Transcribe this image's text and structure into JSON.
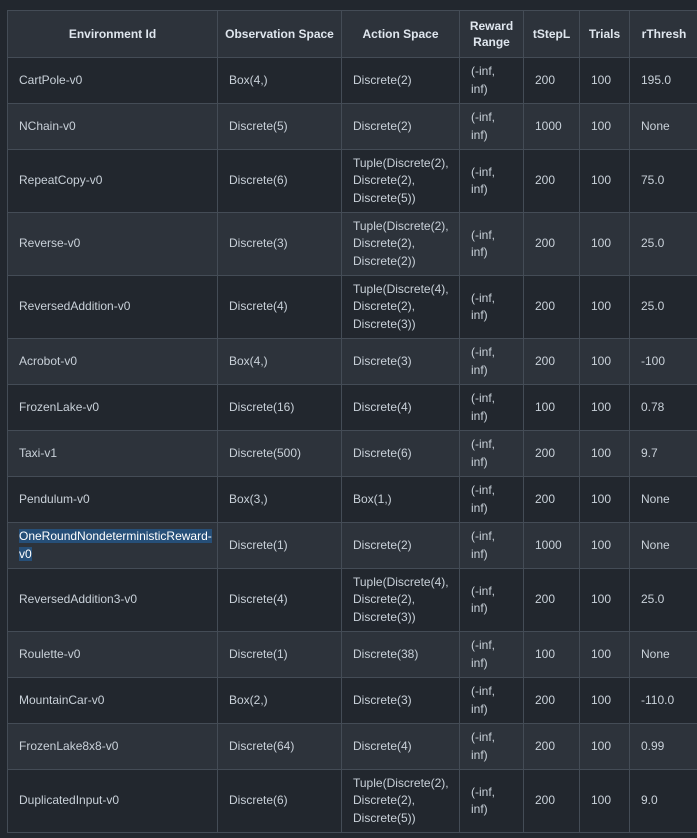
{
  "columns": [
    "Environment Id",
    "Observation Space",
    "Action Space",
    "Reward Range",
    "tStepL",
    "Trials",
    "rThresh"
  ],
  "rows": [
    {
      "env": "CartPole-v0",
      "obs": "Box(4,)",
      "act": [
        "Discrete(2)"
      ],
      "reward": [
        "(-inf,",
        "inf)"
      ],
      "tstep": "200",
      "trials": "100",
      "rthresh": "195.0"
    },
    {
      "env": "NChain-v0",
      "obs": "Discrete(5)",
      "act": [
        "Discrete(2)"
      ],
      "reward": [
        "(-inf,",
        "inf)"
      ],
      "tstep": "1000",
      "trials": "100",
      "rthresh": "None"
    },
    {
      "env": "RepeatCopy-v0",
      "obs": "Discrete(6)",
      "act": [
        "Tuple(Discrete(2),",
        "Discrete(2),",
        "Discrete(5))"
      ],
      "reward": [
        "(-inf,",
        "inf)"
      ],
      "tstep": "200",
      "trials": "100",
      "rthresh": "75.0"
    },
    {
      "env": "Reverse-v0",
      "obs": "Discrete(3)",
      "act": [
        "Tuple(Discrete(2),",
        "Discrete(2),",
        "Discrete(2))"
      ],
      "reward": [
        "(-inf,",
        "inf)"
      ],
      "tstep": "200",
      "trials": "100",
      "rthresh": "25.0"
    },
    {
      "env": "ReversedAddition-v0",
      "obs": "Discrete(4)",
      "act": [
        "Tuple(Discrete(4),",
        "Discrete(2),",
        "Discrete(3))"
      ],
      "reward": [
        "(-inf,",
        "inf)"
      ],
      "tstep": "200",
      "trials": "100",
      "rthresh": "25.0"
    },
    {
      "env": "Acrobot-v0",
      "obs": "Box(4,)",
      "act": [
        "Discrete(3)"
      ],
      "reward": [
        "(-inf,",
        "inf)"
      ],
      "tstep": "200",
      "trials": "100",
      "rthresh": "-100"
    },
    {
      "env": "FrozenLake-v0",
      "obs": "Discrete(16)",
      "act": [
        "Discrete(4)"
      ],
      "reward": [
        "(-inf,",
        "inf)"
      ],
      "tstep": "100",
      "trials": "100",
      "rthresh": "0.78"
    },
    {
      "env": "Taxi-v1",
      "obs": "Discrete(500)",
      "act": [
        "Discrete(6)"
      ],
      "reward": [
        "(-inf,",
        "inf)"
      ],
      "tstep": "200",
      "trials": "100",
      "rthresh": "9.7"
    },
    {
      "env": "Pendulum-v0",
      "obs": "Box(3,)",
      "act": [
        "Box(1,)"
      ],
      "reward": [
        "(-inf,",
        "inf)"
      ],
      "tstep": "200",
      "trials": "100",
      "rthresh": "None"
    },
    {
      "env": "OneRoundNondeterministicReward-v0",
      "env_lines": [
        "OneRoundNondeterministicReward-",
        "v0"
      ],
      "highlighted": true,
      "obs": "Discrete(1)",
      "act": [
        "Discrete(2)"
      ],
      "reward": [
        "(-inf,",
        "inf)"
      ],
      "tstep": "1000",
      "trials": "100",
      "rthresh": "None"
    },
    {
      "env": "ReversedAddition3-v0",
      "obs": "Discrete(4)",
      "act": [
        "Tuple(Discrete(4),",
        "Discrete(2),",
        "Discrete(3))"
      ],
      "reward": [
        "(-inf,",
        "inf)"
      ],
      "tstep": "200",
      "trials": "100",
      "rthresh": "25.0"
    },
    {
      "env": "Roulette-v0",
      "obs": "Discrete(1)",
      "act": [
        "Discrete(38)"
      ],
      "reward": [
        "(-inf,",
        "inf)"
      ],
      "tstep": "100",
      "trials": "100",
      "rthresh": "None"
    },
    {
      "env": "MountainCar-v0",
      "obs": "Box(2,)",
      "act": [
        "Discrete(3)"
      ],
      "reward": [
        "(-inf,",
        "inf)"
      ],
      "tstep": "200",
      "trials": "100",
      "rthresh": "-110.0"
    },
    {
      "env": "FrozenLake8x8-v0",
      "obs": "Discrete(64)",
      "act": [
        "Discrete(4)"
      ],
      "reward": [
        "(-inf,",
        "inf)"
      ],
      "tstep": "200",
      "trials": "100",
      "rthresh": "0.99"
    },
    {
      "env": "DuplicatedInput-v0",
      "obs": "Discrete(6)",
      "act": [
        "Tuple(Discrete(2),",
        "Discrete(2),",
        "Discrete(5))"
      ],
      "reward": [
        "(-inf,",
        "inf)"
      ],
      "tstep": "200",
      "trials": "100",
      "rthresh": "9.0"
    }
  ],
  "colors": {
    "background": "#22272e",
    "row_alt": "#2d333b",
    "border": "#444c56",
    "text": "#c9d1d9",
    "selection": "#264f78"
  }
}
